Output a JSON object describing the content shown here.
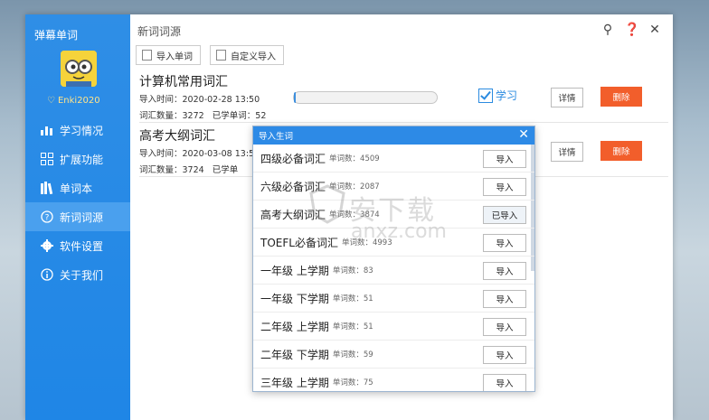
{
  "app": {
    "title": "弹幕单词",
    "username": "Enki2020"
  },
  "sidebar": {
    "items": [
      {
        "label": "学习情况",
        "icon": "bar-chart-icon"
      },
      {
        "label": "扩展功能",
        "icon": "grid-icon"
      },
      {
        "label": "单词本",
        "icon": "books-icon"
      },
      {
        "label": "新词词源",
        "icon": "question-circle-icon"
      },
      {
        "label": "软件设置",
        "icon": "gear-icon"
      },
      {
        "label": "关于我们",
        "icon": "info-circle-icon"
      }
    ],
    "active_index": 3
  },
  "main": {
    "title": "新词词源",
    "toolbar": {
      "import_words": "导入单词",
      "custom_import": "自定义导入"
    },
    "libraries": [
      {
        "name": "计算机常用词汇",
        "import_time_label": "导入时间：",
        "import_time": "2020-02-28 13:50",
        "count_label": "词汇数量：",
        "count": "3272",
        "learned_label": "已学单词：",
        "learned": "52",
        "study_label": "学习",
        "detail_label": "详情",
        "delete_label": "删除"
      },
      {
        "name": "高考大纲词汇",
        "import_time_label": "导入时间：",
        "import_time": "2020-03-08 13:5",
        "count_label": "词汇数量：",
        "count": "3724",
        "learned_label": "已学单",
        "detail_label": "详情",
        "delete_label": "删除"
      }
    ]
  },
  "dialog": {
    "title": "导入生词",
    "count_label": "单词数：",
    "rows": [
      {
        "name": "四级必备词汇",
        "count": "4509",
        "button": "导入"
      },
      {
        "name": "六级必备词汇",
        "count": "2087",
        "button": "导入"
      },
      {
        "name": "高考大纲词汇",
        "count": "3874",
        "button": "已导入"
      },
      {
        "name": "TOEFL必备词汇",
        "count": "4993",
        "button": "导入"
      },
      {
        "name": "一年级 上学期",
        "count": "83",
        "button": "导入"
      },
      {
        "name": "一年级 下学期",
        "count": "51",
        "button": "导入"
      },
      {
        "name": "二年级 上学期",
        "count": "51",
        "button": "导入"
      },
      {
        "name": "二年级 下学期",
        "count": "59",
        "button": "导入"
      },
      {
        "name": "三年级 上学期",
        "count": "75",
        "button": "导入"
      }
    ]
  },
  "watermark": {
    "text": "安下载",
    "sub": "anxz.com"
  },
  "colors": {
    "sidebar": "#2f8ee6",
    "accent": "#2d8ae6",
    "delete": "#f25e2b"
  }
}
